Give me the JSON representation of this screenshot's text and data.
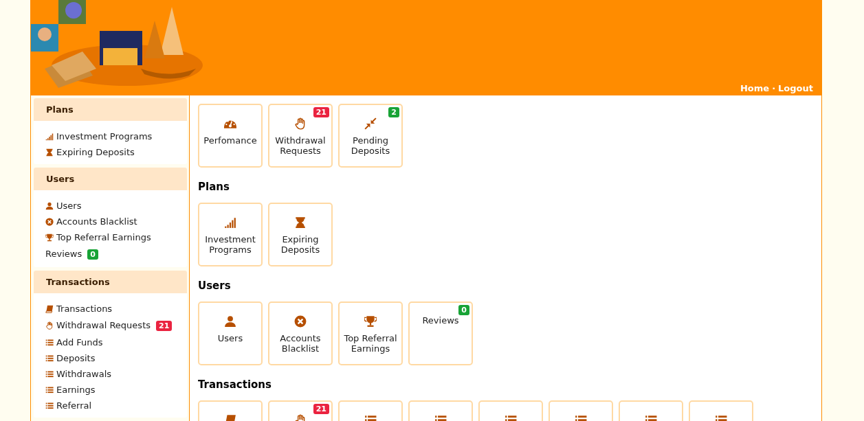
{
  "header": {
    "kind": "picture",
    "nav": [
      {
        "label": "Home"
      },
      {
        "label": "Logout"
      }
    ],
    "separator": "·"
  },
  "sidebar": {
    "sections": [
      {
        "title": "Plans",
        "items": [
          {
            "label": "Investment Programs",
            "kind": "signal"
          },
          {
            "label": "Expiring Deposits",
            "kind": "hourglass"
          }
        ]
      },
      {
        "title": "Users",
        "items": [
          {
            "label": "Users",
            "kind": "user"
          },
          {
            "label": "Accounts Blacklist",
            "kind": "xcircle"
          },
          {
            "label": "Top Referral Earnings",
            "kind": "trophy"
          },
          {
            "label": "Reviews",
            "kind": "none",
            "badge": {
              "text": "0",
              "color": "#18a336"
            }
          }
        ]
      },
      {
        "title": "Transactions",
        "items": [
          {
            "label": "Transactions",
            "kind": "book"
          },
          {
            "label": "Withdrawal Requests",
            "kind": "hand",
            "badge": {
              "text": "21",
              "color": "#ea2340"
            }
          },
          {
            "label": "Add Funds",
            "kind": "list"
          },
          {
            "label": "Deposits",
            "kind": "list"
          },
          {
            "label": "Withdrawals",
            "kind": "list"
          },
          {
            "label": "Earnings",
            "kind": "list"
          },
          {
            "label": "Referral",
            "kind": "list"
          }
        ]
      }
    ]
  },
  "main": {
    "sections": [
      {
        "tiles": [
          {
            "label": "Perfomance",
            "kind": "gauge"
          },
          {
            "label": "Withdrawal Requests",
            "kind": "hand",
            "badge": {
              "text": "21",
              "color": "#ea2340"
            }
          },
          {
            "label": "Pending Deposits",
            "kind": "compress",
            "badge": {
              "text": "2",
              "color": "#18a336"
            }
          }
        ]
      },
      {
        "heading": "Plans",
        "tiles": [
          {
            "label": "Investment Programs",
            "kind": "signal"
          },
          {
            "label": "Expiring Deposits",
            "kind": "hourglass"
          }
        ]
      },
      {
        "heading": "Users",
        "tiles": [
          {
            "label": "Users",
            "kind": "user"
          },
          {
            "label": "Accounts Blacklist",
            "kind": "xcircle"
          },
          {
            "label": "Top Referral Earnings",
            "kind": "trophy"
          },
          {
            "label": "Reviews",
            "kind": "none",
            "badge": {
              "text": "0",
              "color": "#18a336"
            }
          }
        ]
      },
      {
        "heading": "Transactions",
        "tiles": [
          {
            "kind": "book"
          },
          {
            "kind": "hand",
            "badge": {
              "text": "21",
              "color": "#ea2340"
            }
          },
          {
            "kind": "list"
          },
          {
            "kind": "list"
          },
          {
            "kind": "list"
          },
          {
            "kind": "list"
          },
          {
            "kind": "list"
          },
          {
            "kind": "list"
          }
        ]
      }
    ]
  }
}
